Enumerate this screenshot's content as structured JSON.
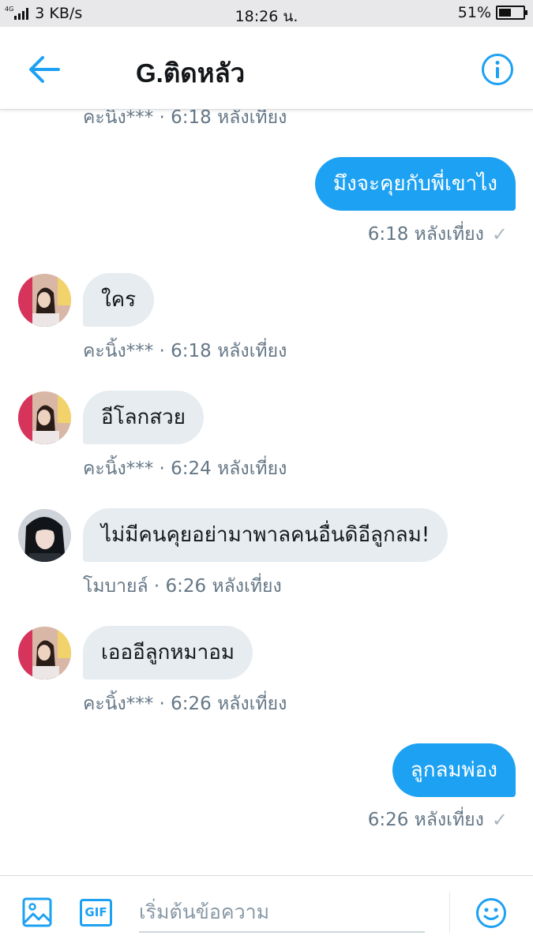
{
  "status_bar": {
    "network": "4G",
    "speed": "3 KB/s",
    "time": "18:26 น.",
    "battery": "51%",
    "battery_level": 0.51
  },
  "header": {
    "title": "G.ติดหลัว",
    "back_icon": "arrow-left-icon",
    "info_icon": "info-circle-icon"
  },
  "messages": [
    {
      "direction": "in",
      "meta": "คะนิ้ง*** · 6:18 หลังเที่ยง",
      "partial": true
    },
    {
      "direction": "out",
      "text": "มึงจะคุยกับพี่เขาไง",
      "meta": "6:18 หลังเที่ยง"
    },
    {
      "direction": "in",
      "text": "ใคร",
      "sender": "คะนิ้ง***",
      "meta": "คะนิ้ง*** · 6:18 หลังเที่ยง"
    },
    {
      "direction": "in",
      "text": "อีโลกสวย",
      "sender": "คะนิ้ง***",
      "meta": "คะนิ้ง*** · 6:24 หลังเที่ยง"
    },
    {
      "direction": "in",
      "text": "ไม่มีคนคุยอย่ามาพาลคนอื่นดิอีลูกลม!",
      "sender": "โมบายล์",
      "meta": "โมบายล์ · 6:26 หลังเที่ยง"
    },
    {
      "direction": "in",
      "text": "เอออีลูกหมาอม",
      "sender": "คะนิ้ง***",
      "meta": "คะนิ้ง*** · 6:26 หลังเที่ยง"
    },
    {
      "direction": "out",
      "text": "ลูกลมพ่อง",
      "meta": "6:26 หลังเที่ยง"
    }
  ],
  "composer": {
    "placeholder": "เริ่มต้นข้อความ",
    "gif_label": "GIF",
    "media_icon": "image-icon",
    "emoji_icon": "smiley-icon"
  },
  "colors": {
    "accent": "#1da1f2",
    "incoming_bubble": "#e6ecf0",
    "meta_text": "#657786"
  }
}
